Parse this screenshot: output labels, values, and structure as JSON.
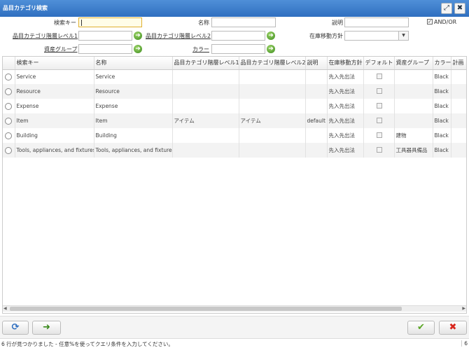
{
  "window": {
    "title": "品目カテゴリ検索"
  },
  "colors": {
    "titlebar": "#2f6fc0",
    "go_icon": "#3a8a1c",
    "ok_icon": "#5aa524",
    "cancel_icon": "#d8261d"
  },
  "form": {
    "search_key_label": "検索キー",
    "name_label": "名称",
    "description_label": "説明",
    "and_or_label": "AND/OR",
    "and_or_checked": true,
    "level1_label": "品目カテゴリ階層レベル1",
    "level2_label": "品目カテゴリ階層レベル2",
    "movement_label": "在庫移動方針",
    "asset_group_label": "資産グループ",
    "color_label": "カラー"
  },
  "table": {
    "columns": [
      "検索キー",
      "名称",
      "品目カテゴリ階層レベル1",
      "品目カテゴリ階層レベル2",
      "説明",
      "在庫移動方針",
      "デフォルト",
      "資産グループ",
      "カラー",
      "計画"
    ],
    "rows": [
      [
        "Service",
        "Service",
        "",
        "",
        "",
        "先入先出法",
        "",
        "",
        "Black",
        ""
      ],
      [
        "Resource",
        "Resource",
        "",
        "",
        "",
        "先入先出法",
        "",
        "",
        "Black",
        ""
      ],
      [
        "Expense",
        "Expense",
        "",
        "",
        "",
        "先入先出法",
        "",
        "",
        "Black",
        ""
      ],
      [
        "Item",
        "Item",
        "アイテム",
        "アイテム",
        "default",
        "先入先出法",
        "",
        "",
        "Black",
        ""
      ],
      [
        "Building",
        "Building",
        "",
        "",
        "",
        "先入先出法",
        "",
        "建物",
        "Black",
        ""
      ],
      [
        "Tools, appliances, and fixtures",
        "Tools, appliances, and fixtures",
        "",
        "",
        "",
        "先入先出法",
        "",
        "工具器具備品",
        "Black",
        ""
      ]
    ]
  },
  "status": {
    "message": "6 行が見つかりました - 任意%を使ってクエリ条件を入力してください。",
    "count": "6"
  }
}
